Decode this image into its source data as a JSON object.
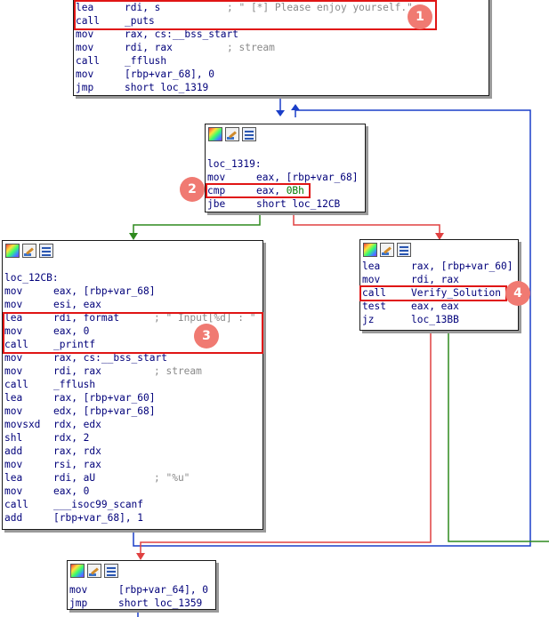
{
  "colors": {
    "edge_true": "#2e8a1e",
    "edge_false": "#e04040",
    "edge_back": "#1a3ec8",
    "highlight": "#e01515",
    "badge": "#f07a72"
  },
  "icons": [
    "graph-color-icon",
    "edit-pencil-icon",
    "instruction-list-icon"
  ],
  "block_top": {
    "lines": [
      {
        "mn": "lea",
        "op": "rdi, s",
        "cm": "; \" [*] Please enjoy yourself.\""
      },
      {
        "mn": "call",
        "op": "_puts"
      },
      {
        "mn": "mov",
        "op": "rax, cs:__bss_start"
      },
      {
        "mn": "mov",
        "op": "rdi, rax",
        "cm": "; stream"
      },
      {
        "mn": "call",
        "op": "_fflush"
      },
      {
        "mn": "mov",
        "op": "[rbp+var_68], 0"
      },
      {
        "mn": "jmp",
        "op": "short loc_1319"
      }
    ]
  },
  "block_loop": {
    "label": "loc_1319:",
    "lines": [
      {
        "mn": "mov",
        "op": "eax, [rbp+var_68]"
      },
      {
        "mn": "cmp",
        "op_a": "eax, ",
        "op_num": "0Bh"
      },
      {
        "mn": "jbe",
        "op": "short loc_12CB"
      }
    ]
  },
  "block_input": {
    "label": "loc_12CB:",
    "lines": [
      {
        "mn": "mov",
        "op": "eax, [rbp+var_68]"
      },
      {
        "mn": "mov",
        "op": "esi, eax"
      },
      {
        "mn": "lea",
        "op": "rdi, format",
        "cm": "; \" Input[%d] : \""
      },
      {
        "mn": "mov",
        "op": "eax, 0"
      },
      {
        "mn": "call",
        "op": "_printf"
      },
      {
        "mn": "mov",
        "op": "rax, cs:__bss_start"
      },
      {
        "mn": "mov",
        "op": "rdi, rax",
        "cm": "; stream"
      },
      {
        "mn": "call",
        "op": "_fflush"
      },
      {
        "mn": "lea",
        "op": "rax, [rbp+var_60]"
      },
      {
        "mn": "mov",
        "op": "edx, [rbp+var_68]"
      },
      {
        "mn": "movsxd",
        "op": "rdx, edx"
      },
      {
        "mn": "shl",
        "op": "rdx, 2"
      },
      {
        "mn": "add",
        "op": "rax, rdx"
      },
      {
        "mn": "mov",
        "op": "rsi, rax"
      },
      {
        "mn": "lea",
        "op": "rdi, aU",
        "cm": "; \"%u\""
      },
      {
        "mn": "mov",
        "op": "eax, 0"
      },
      {
        "mn": "call",
        "op": "___isoc99_scanf"
      },
      {
        "mn": "add",
        "op": "[rbp+var_68], 1"
      }
    ]
  },
  "block_verify": {
    "lines": [
      {
        "mn": "lea",
        "op": "rax, [rbp+var_60]"
      },
      {
        "mn": "mov",
        "op": "rdi, rax"
      },
      {
        "mn": "call",
        "op": "Verify_Solution"
      },
      {
        "mn": "test",
        "op": "eax, eax"
      },
      {
        "mn": "jz",
        "op": "loc_13BB"
      }
    ]
  },
  "block_bottom": {
    "lines": [
      {
        "mn": "mov",
        "op": "[rbp+var_64], 0"
      },
      {
        "mn": "jmp",
        "op": "short loc_1359"
      }
    ]
  },
  "badges": [
    "1",
    "2",
    "3",
    "4"
  ]
}
